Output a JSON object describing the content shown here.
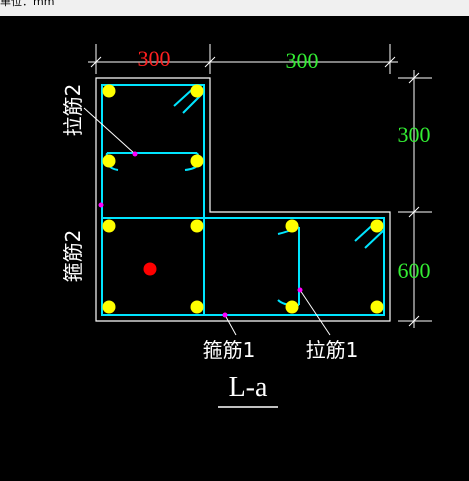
{
  "header": {
    "unit_text": "单位：mm"
  },
  "dimensions": {
    "top_left": "300",
    "top_right": "300",
    "right_upper": "300",
    "right_lower": "600"
  },
  "labels": {
    "tie_bar_2": "拉筋2",
    "stirrup_2": "箍筋2",
    "stirrup_1": "箍筋1",
    "tie_bar_1": "拉筋1"
  },
  "section_title": "L-a",
  "colors": {
    "background": "#000000",
    "outline": "#ffffff",
    "stirrup": "#00e5ff",
    "rebar": "#ffff00",
    "dimension_red": "#ff2020",
    "dimension_green": "#33ee33",
    "leader_dot": "#ff00ff",
    "center_point": "#ff0000"
  }
}
